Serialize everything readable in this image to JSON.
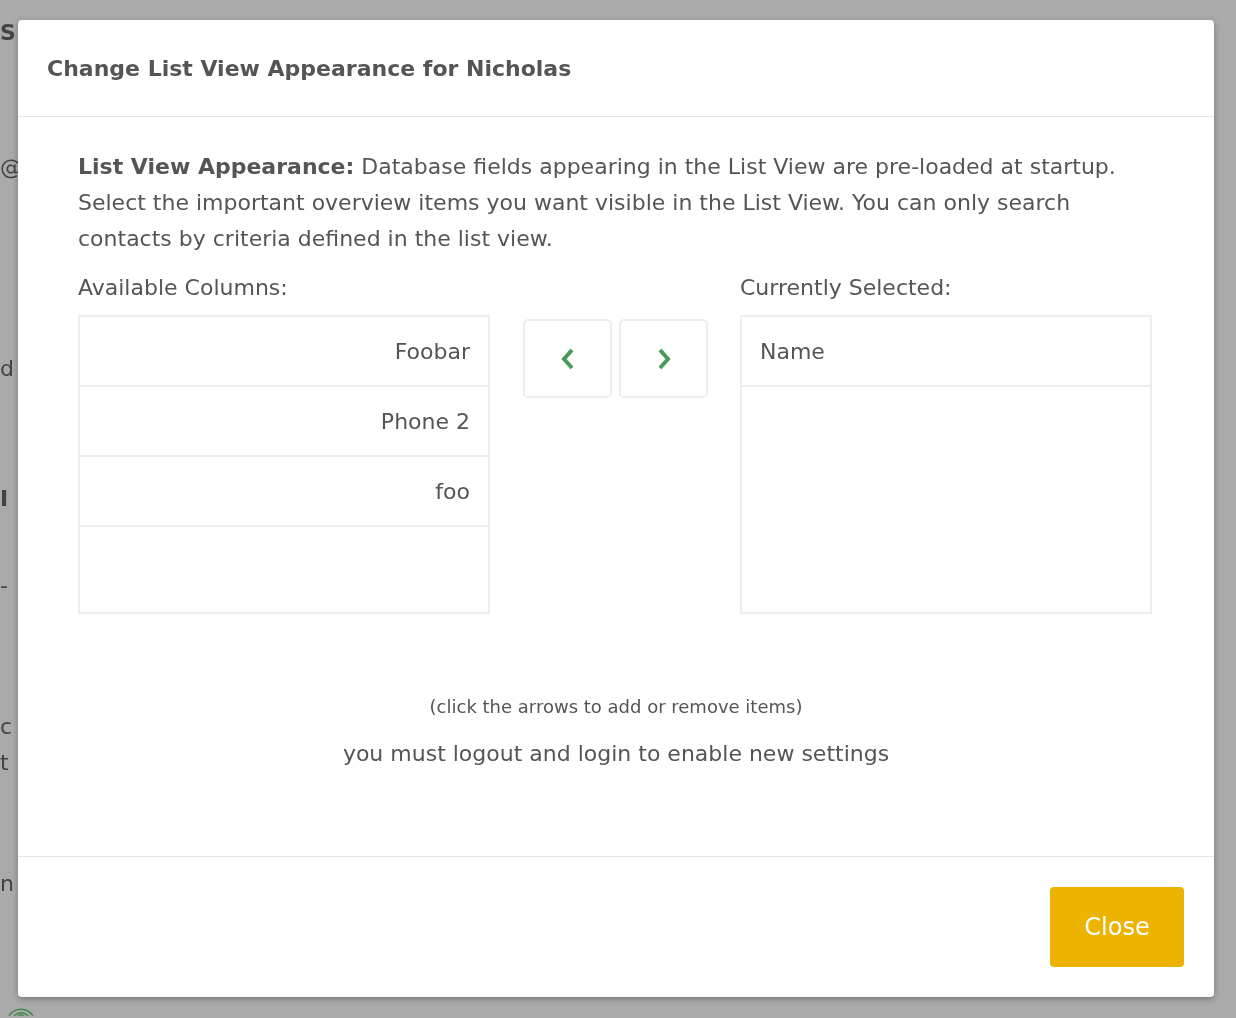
{
  "background_fragments": [
    "S",
    "@",
    "d",
    "I",
    "-",
    "c",
    "t",
    "n"
  ],
  "dialog": {
    "title": "Change List View Appearance for Nicholas",
    "intro": "**List View Appearance:** Database fields appearing in the List View are pre-loaded at startup. Select the important overview items you want visible in the List View. You can only search contacts by criteria defined in the list view.",
    "available": {
      "label": "Available Columns:",
      "items": [
        "Foobar",
        "Phone 2",
        "foo"
      ]
    },
    "arrows": [
      {
        "kind": "left"
      },
      {
        "kind": "right"
      }
    ],
    "selected": {
      "label": "Currently Selected:",
      "items": [
        "Name"
      ]
    },
    "hint": "(click the arrows to add or remove items)",
    "note": "you must logout and login to enable new settings",
    "close_button": "Close"
  }
}
